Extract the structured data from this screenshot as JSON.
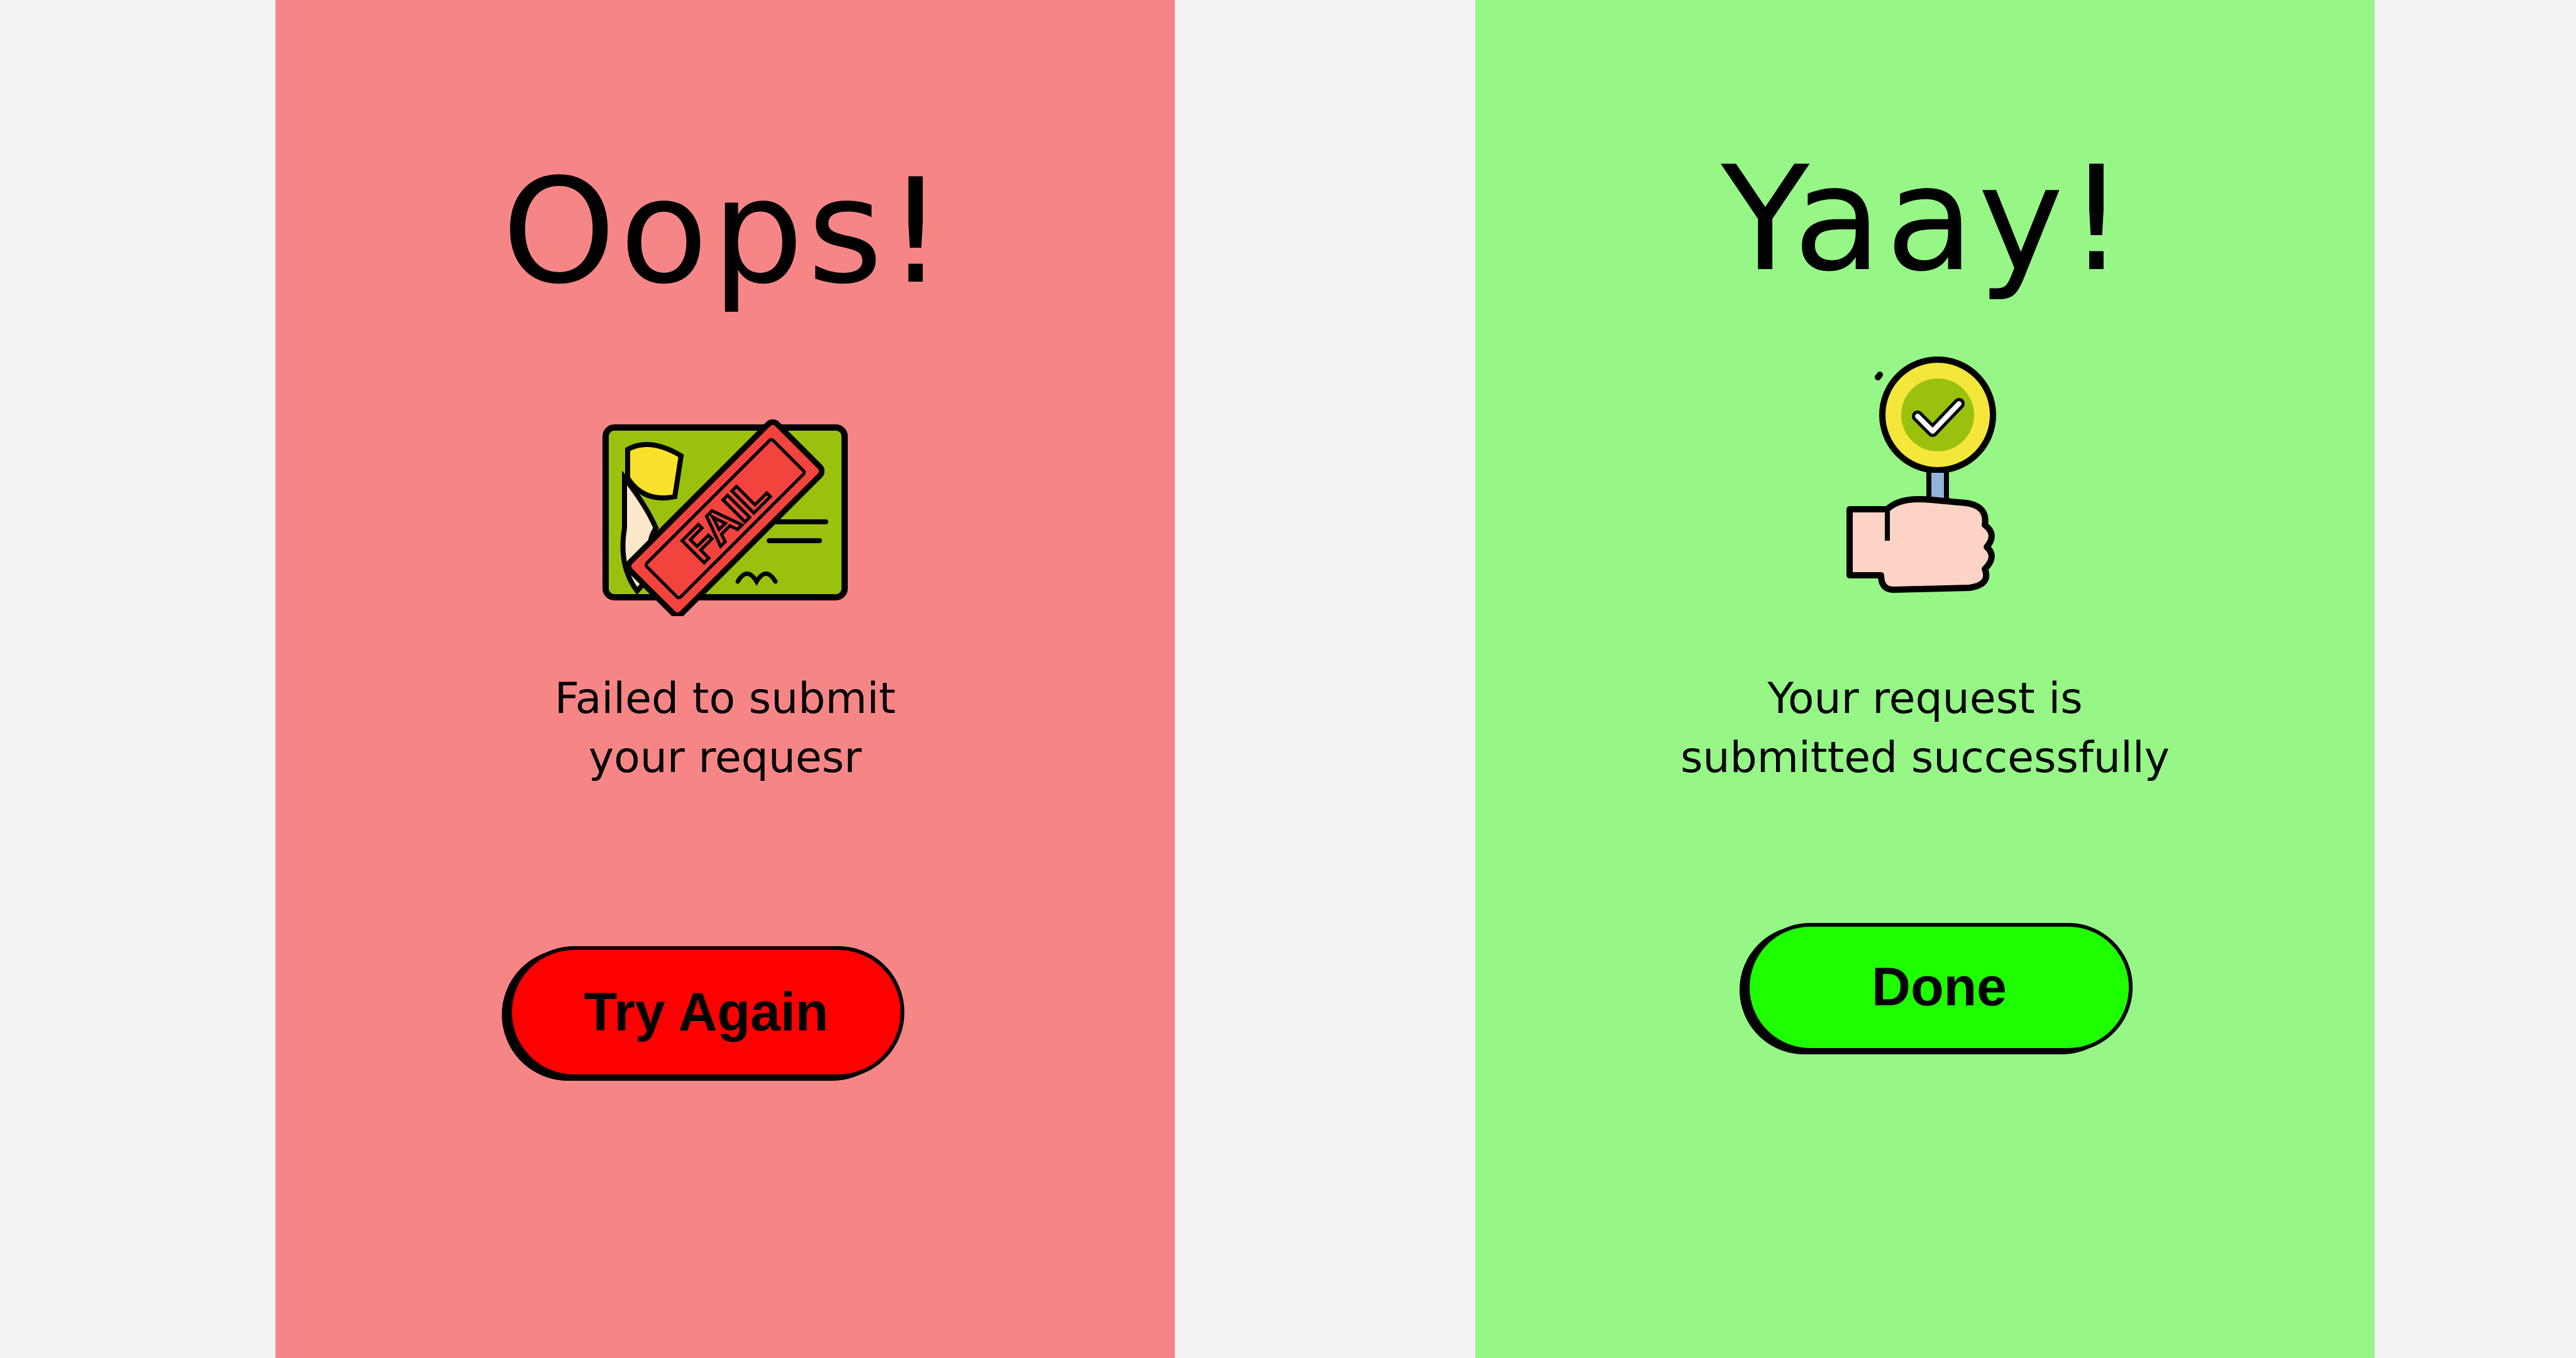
{
  "fail_panel": {
    "title": "Oops!",
    "message_line1": "Failed to submit",
    "message_line2": "your requesr",
    "button_label": "Try Again",
    "stamp_text": "FAIL",
    "background_color": "#f68686",
    "button_color": "#ff0000",
    "icon": "fail-certificate-icon"
  },
  "success_panel": {
    "title": "Yaay!",
    "message_line1": "Your request is",
    "message_line2": "submitted successfully",
    "button_label": "Done",
    "background_color": "#96f787",
    "button_color": "#1eff00",
    "icon": "hand-holding-check-sign-icon"
  },
  "page_background": "#f2f2f2"
}
